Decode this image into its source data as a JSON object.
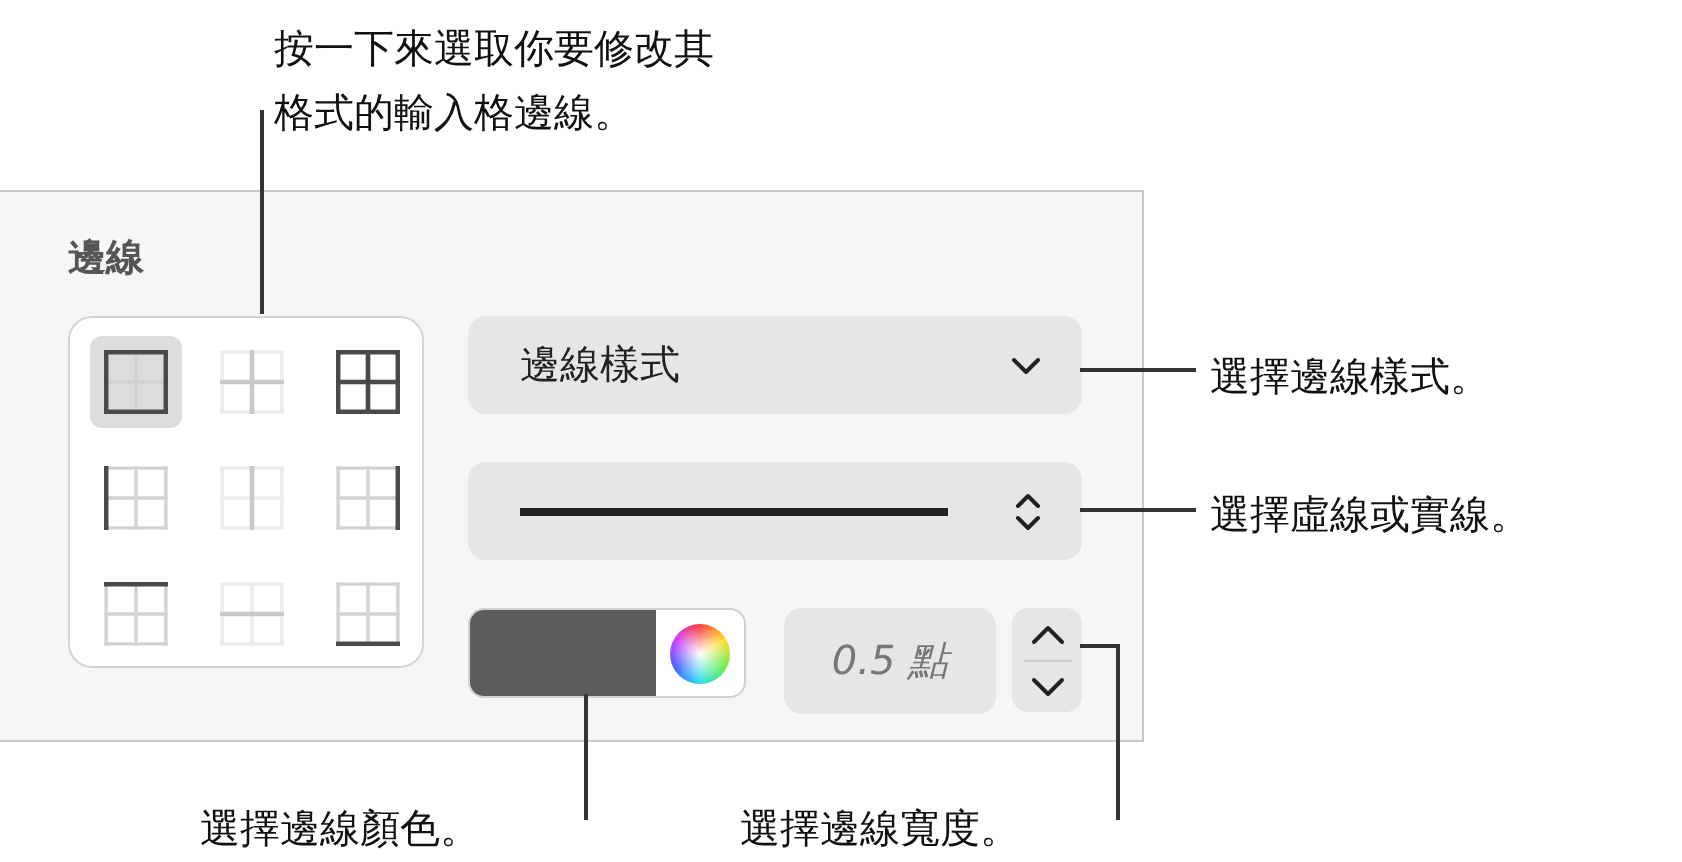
{
  "callouts": [
    {
      "text": "按一下來選取你要修改其格式的輸入格邊線。"
    },
    {
      "text": "選擇邊線樣式。"
    },
    {
      "text": "選擇虛線或實線。"
    },
    {
      "text": "選擇邊線顏色。"
    },
    {
      "text": "選擇邊線寬度。"
    }
  ],
  "panel": {
    "title": "邊線",
    "border_buttons": [
      {
        "kind": "outer",
        "selected": true,
        "disabled": false
      },
      {
        "kind": "inner",
        "selected": false,
        "disabled": true
      },
      {
        "kind": "all",
        "selected": false,
        "disabled": false
      },
      {
        "kind": "left",
        "selected": false,
        "disabled": false
      },
      {
        "kind": "vertical",
        "selected": false,
        "disabled": true
      },
      {
        "kind": "right",
        "selected": false,
        "disabled": false
      },
      {
        "kind": "top",
        "selected": false,
        "disabled": false
      },
      {
        "kind": "horizontal",
        "selected": false,
        "disabled": true
      },
      {
        "kind": "bottom",
        "selected": false,
        "disabled": false
      }
    ],
    "style_menu": {
      "value": "邊線樣式"
    },
    "color_well": {
      "color": "#5c5c5c"
    },
    "width_field": {
      "value": "0.5 點"
    }
  }
}
